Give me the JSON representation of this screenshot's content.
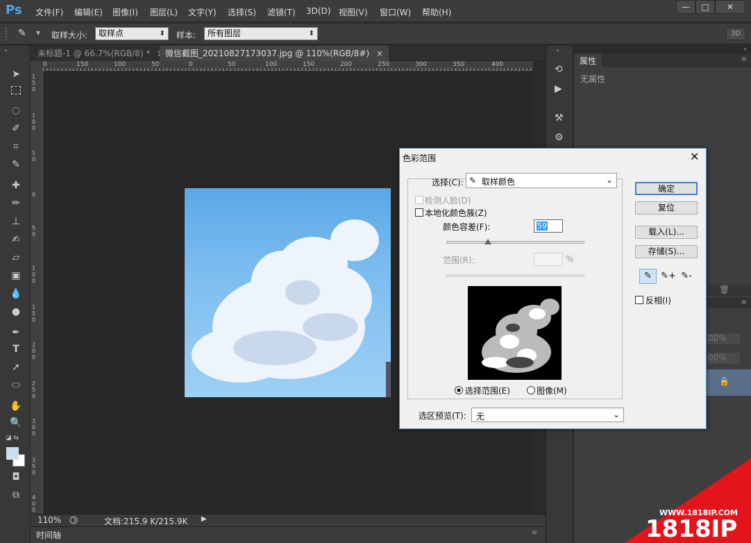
{
  "app": {
    "logo": "Ps",
    "menu": [
      "文件(F)",
      "编辑(E)",
      "图像(I)",
      "图层(L)",
      "文字(Y)",
      "选择(S)",
      "滤镜(T)",
      "3D(D)",
      "视图(V)",
      "窗口(W)",
      "帮助(H)"
    ],
    "window_controls": [
      "—",
      "□",
      "✕"
    ]
  },
  "options_bar": {
    "sample_size_label": "取样大小:",
    "sample_size_value": "取样点",
    "sample_label": "样本:",
    "sample_value": "所有图层",
    "btn_3d": "3D"
  },
  "tabs": [
    {
      "label": "未标题-1 @ 66.7%(RGB/8) *",
      "close": "×"
    },
    {
      "label": "微信截图_20210827173037.jpg @ 110%(RGB/8#)",
      "close": "×"
    }
  ],
  "ruler": {
    "h_ticks": [
      "0",
      "150",
      "100",
      "50",
      "0",
      "50",
      "100",
      "150",
      "200",
      "250",
      "300",
      "350",
      "400"
    ],
    "v_ticks": [
      "150",
      "100",
      "50",
      "0",
      "50",
      "100",
      "150",
      "200",
      "250",
      "300",
      "350",
      "400"
    ]
  },
  "status": {
    "zoom": "110%",
    "doc_info": "文档:215.9 K/215.9K",
    "timeline": "时间轴"
  },
  "properties_panel": {
    "tab": "属性",
    "content": "无属性",
    "opacity_partial_1": "00%",
    "opacity_partial_2": "00%"
  },
  "dialog": {
    "title": "色彩范围",
    "select_label": "选择(C):",
    "select_value": "取样颜色",
    "detect_faces": "检测人脸(D)",
    "localized_clusters": "本地化颜色簇(Z)",
    "fuzziness_label": "颜色容差(F):",
    "fuzziness_value": "59",
    "fuzziness_level": 0.3,
    "range_label": "范围(R):",
    "range_unit": "%",
    "radio_selection": "选择范围(E)",
    "radio_image": "图像(M)",
    "preview_label": "选区预览(T):",
    "preview_value": "无",
    "btn_ok": "确定",
    "btn_reset": "复位",
    "btn_load": "载入(L)...",
    "btn_save": "存储(S)...",
    "invert": "反相(I)"
  },
  "watermark": {
    "url": "WWW.1818IP.COM",
    "brand": "1818IP"
  }
}
